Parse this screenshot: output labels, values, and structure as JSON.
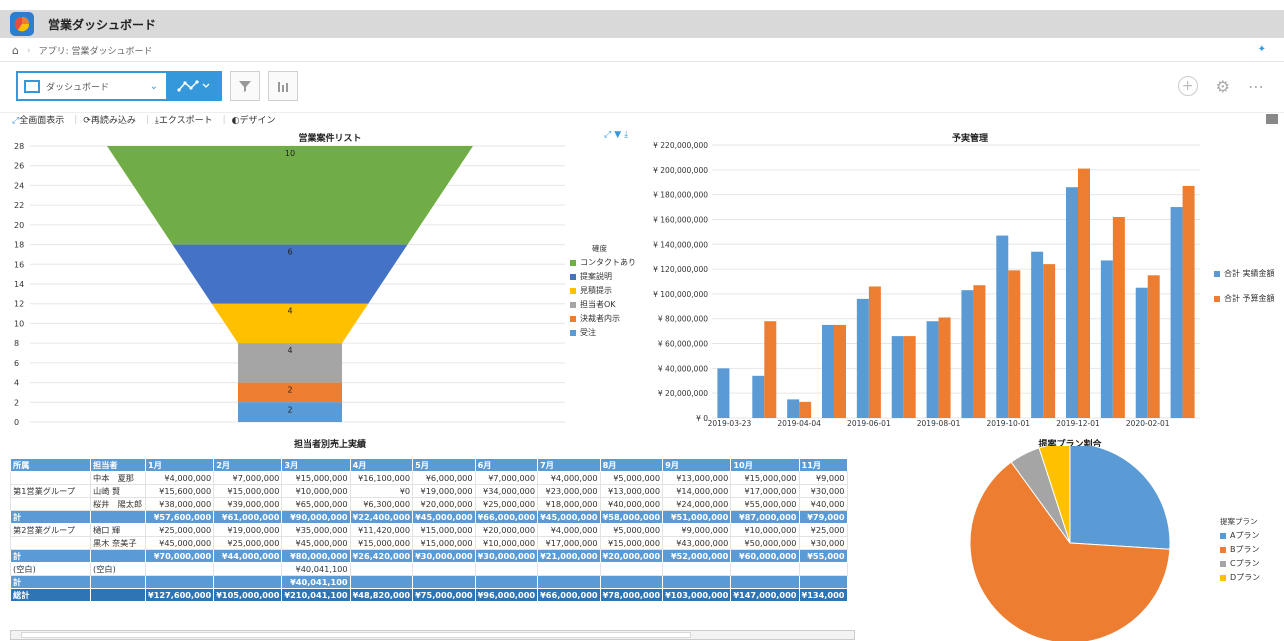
{
  "app": {
    "title": "営業ダッシュボード",
    "breadcrumb": "アプリ: 営業ダッシュボード"
  },
  "toolbar": {
    "view_name": "ダッシュボード"
  },
  "actions": {
    "fullscreen": "全画面表示",
    "reload": "再読み込み",
    "export": "エクスポート",
    "design": "デザイン"
  },
  "colors": {
    "accent": "#3498db",
    "blue": "#5b9bd5",
    "orange": "#ed7d31",
    "green": "#70ad47",
    "gray": "#a5a5a5",
    "yellow": "#ffc000",
    "darkblue": "#4472c4"
  },
  "funnel": {
    "title": "営業案件リスト",
    "legend_title": "確度",
    "y_ticks": [
      "28",
      "26",
      "24",
      "22",
      "20",
      "18",
      "16",
      "14",
      "12",
      "10",
      "8",
      "6",
      "4",
      "2",
      "0"
    ],
    "chart_data": {
      "type": "funnel",
      "ylim": [
        0,
        28
      ],
      "stages": [
        {
          "name": "コンタクトあり",
          "value": 10,
          "color": "#70ad47"
        },
        {
          "name": "提案説明",
          "value": 6,
          "color": "#4472c4"
        },
        {
          "name": "見積提示",
          "value": 4,
          "color": "#ffc000"
        },
        {
          "name": "担当者OK",
          "value": 4,
          "color": "#a5a5a5"
        },
        {
          "name": "決裁者内示",
          "value": 2,
          "color": "#ed7d31"
        },
        {
          "name": "受注",
          "value": 2,
          "color": "#5b9bd5"
        }
      ]
    }
  },
  "budget": {
    "title": "予実管理",
    "y_ticks": [
      "¥ 220,000,000",
      "¥ 200,000,000",
      "¥ 180,000,000",
      "¥ 160,000,000",
      "¥ 140,000,000",
      "¥ 120,000,000",
      "¥ 100,000,000",
      "¥ 80,000,000",
      "¥ 60,000,000",
      "¥ 40,000,000",
      "¥ 20,000,000",
      "¥ 0"
    ],
    "x_labels": [
      "2019-03-23",
      "2019-04-04",
      "2019-06-01",
      "2019-08-01",
      "2019-10-01",
      "2019-12-01",
      "2020-02-01"
    ],
    "chart_data": {
      "type": "bar",
      "ylim": [
        0,
        220000000
      ],
      "series": [
        {
          "name": "合計 実績金額",
          "color": "#5b9bd5",
          "values": [
            40000000,
            34000000,
            15000000,
            75000000,
            96000000,
            66000000,
            78000000,
            103000000,
            147000000,
            134000000,
            186000000,
            127000000,
            105000000,
            170000000
          ]
        },
        {
          "name": "合計 予算金額",
          "color": "#ed7d31",
          "values": [
            0,
            78000000,
            13000000,
            75000000,
            106000000,
            66000000,
            81000000,
            107000000,
            119000000,
            124000000,
            201000000,
            162000000,
            115000000,
            187000000
          ]
        }
      ]
    }
  },
  "pivot": {
    "title": "担当者別売上実績",
    "headers": [
      "所属",
      "担当者",
      "1月",
      "2月",
      "3月",
      "4月",
      "5月",
      "6月",
      "7月",
      "8月",
      "9月",
      "10月",
      "11月"
    ],
    "rows": [
      {
        "type": "data",
        "group": "",
        "cells": [
          "中本　夏那",
          "¥4,000,000",
          "¥7,000,000",
          "¥15,000,000",
          "¥16,100,000",
          "¥6,000,000",
          "¥7,000,000",
          "¥4,000,000",
          "¥5,000,000",
          "¥13,000,000",
          "¥15,000,000",
          "¥9,000"
        ]
      },
      {
        "type": "data",
        "group": "第1営業グループ",
        "cells": [
          "山崎 賢",
          "¥15,600,000",
          "¥15,000,000",
          "¥10,000,000",
          "¥0",
          "¥19,000,000",
          "¥34,000,000",
          "¥23,000,000",
          "¥13,000,000",
          "¥14,000,000",
          "¥17,000,000",
          "¥30,000"
        ]
      },
      {
        "type": "data",
        "group": "",
        "cells": [
          "桜井　陽太郎",
          "¥38,000,000",
          "¥39,000,000",
          "¥65,000,000",
          "¥6,300,000",
          "¥20,000,000",
          "¥25,000,000",
          "¥18,000,000",
          "¥40,000,000",
          "¥24,000,000",
          "¥55,000,000",
          "¥40,000"
        ]
      },
      {
        "type": "sub",
        "group": "計",
        "cells": [
          "",
          "¥57,600,000",
          "¥61,000,000",
          "¥90,000,000",
          "¥22,400,000",
          "¥45,000,000",
          "¥66,000,000",
          "¥45,000,000",
          "¥58,000,000",
          "¥51,000,000",
          "¥87,000,000",
          "¥79,000"
        ]
      },
      {
        "type": "data",
        "group": "第2営業グループ",
        "cells": [
          "樋口 輝",
          "¥25,000,000",
          "¥19,000,000",
          "¥35,000,000",
          "¥11,420,000",
          "¥15,000,000",
          "¥20,000,000",
          "¥4,000,000",
          "¥5,000,000",
          "¥9,000,000",
          "¥10,000,000",
          "¥25,000"
        ]
      },
      {
        "type": "data",
        "group": "",
        "cells": [
          "黒木 奈美子",
          "¥45,000,000",
          "¥25,000,000",
          "¥45,000,000",
          "¥15,000,000",
          "¥15,000,000",
          "¥10,000,000",
          "¥17,000,000",
          "¥15,000,000",
          "¥43,000,000",
          "¥50,000,000",
          "¥30,000"
        ]
      },
      {
        "type": "sub",
        "group": "計",
        "cells": [
          "",
          "¥70,000,000",
          "¥44,000,000",
          "¥80,000,000",
          "¥26,420,000",
          "¥30,000,000",
          "¥30,000,000",
          "¥21,000,000",
          "¥20,000,000",
          "¥52,000,000",
          "¥60,000,000",
          "¥55,000"
        ]
      },
      {
        "type": "data",
        "group": "(空白)",
        "cells": [
          "(空白)",
          "",
          "",
          "¥40,041,100",
          "",
          "",
          "",
          "",
          "",
          "",
          "",
          ""
        ]
      },
      {
        "type": "sub",
        "group": "計",
        "cells": [
          "",
          "",
          "",
          "¥40,041,100",
          "",
          "",
          "",
          "",
          "",
          "",
          "",
          ""
        ]
      },
      {
        "type": "total",
        "group": "総計",
        "cells": [
          "",
          "¥127,600,000",
          "¥105,000,000",
          "¥210,041,100",
          "¥48,820,000",
          "¥75,000,000",
          "¥96,000,000",
          "¥66,000,000",
          "¥78,000,000",
          "¥103,000,000",
          "¥147,000,000",
          "¥134,000"
        ]
      }
    ]
  },
  "pie": {
    "title": "提案プラン割合",
    "legend_title": "提案プラン",
    "chart_data": {
      "type": "pie",
      "slices": [
        {
          "name": "Aプラン",
          "value": 26,
          "color": "#5b9bd5"
        },
        {
          "name": "Bプラン",
          "value": 64,
          "color": "#ed7d31"
        },
        {
          "name": "Cプラン",
          "value": 5,
          "color": "#a5a5a5"
        },
        {
          "name": "Dプラン",
          "value": 5,
          "color": "#ffc000"
        }
      ]
    }
  }
}
